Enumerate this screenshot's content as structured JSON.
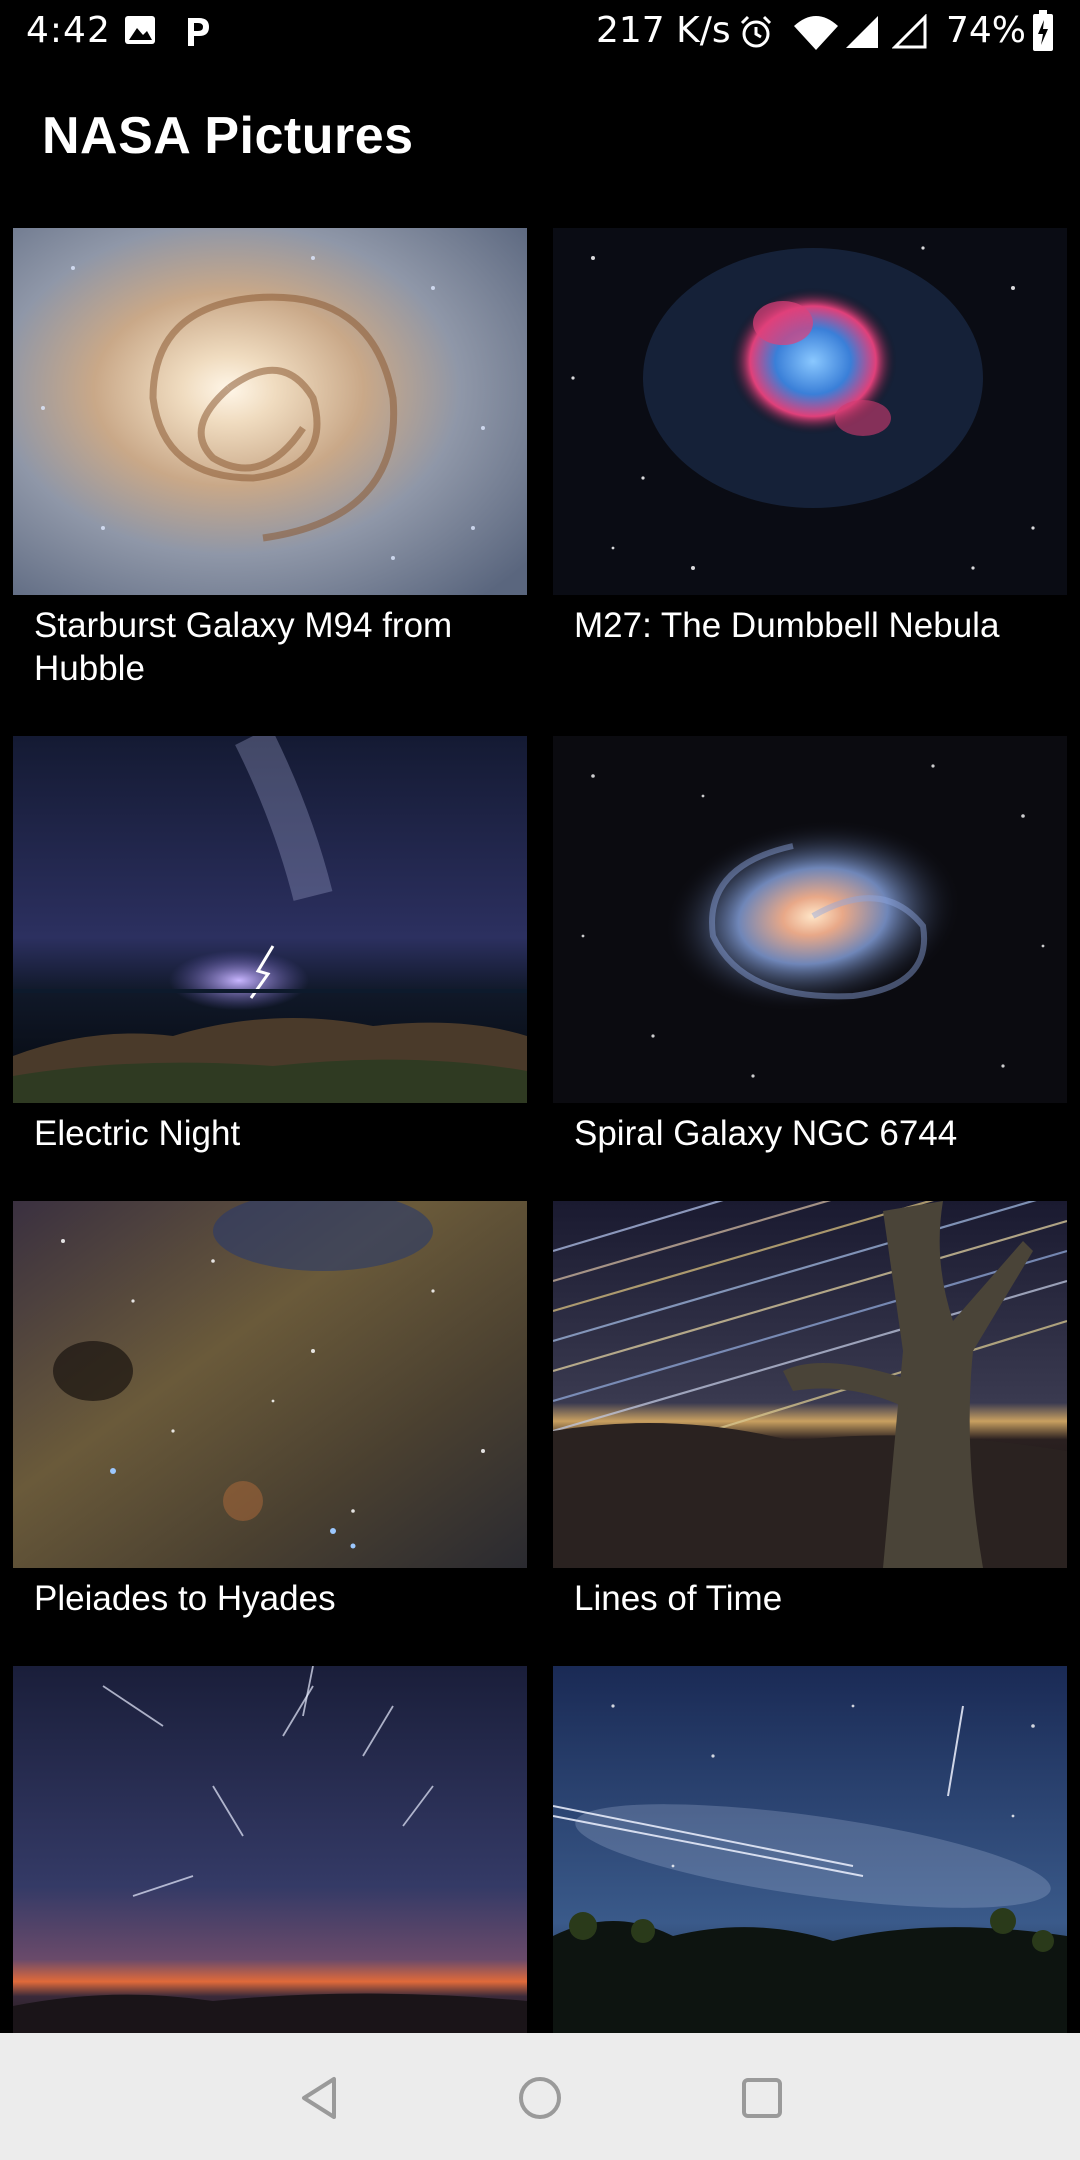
{
  "status_bar": {
    "time": "4:42",
    "net_speed": "217 K/s",
    "battery": "74%",
    "icons": [
      "image-icon",
      "p-app-icon",
      "alarm-icon",
      "wifi-icon",
      "signal-icon",
      "signal-empty-icon",
      "battery-charging-icon"
    ]
  },
  "app": {
    "title": "NASA Pictures"
  },
  "pictures": [
    {
      "title": "Starburst Galaxy M94 from Hubble"
    },
    {
      "title": "M27: The Dumbbell Nebula"
    },
    {
      "title": "Electric Night"
    },
    {
      "title": "Spiral Galaxy NGC 6744"
    },
    {
      "title": "Pleiades to Hyades"
    },
    {
      "title": "Lines of Time"
    },
    {
      "title": ""
    },
    {
      "title": ""
    }
  ],
  "nav_bar": {
    "buttons": [
      "back-button",
      "home-button",
      "recents-button"
    ]
  },
  "colors": {
    "background": "#000000",
    "text": "#ffffff",
    "nav_bar": "#ececec",
    "nav_icon": "#9a9a9a"
  }
}
